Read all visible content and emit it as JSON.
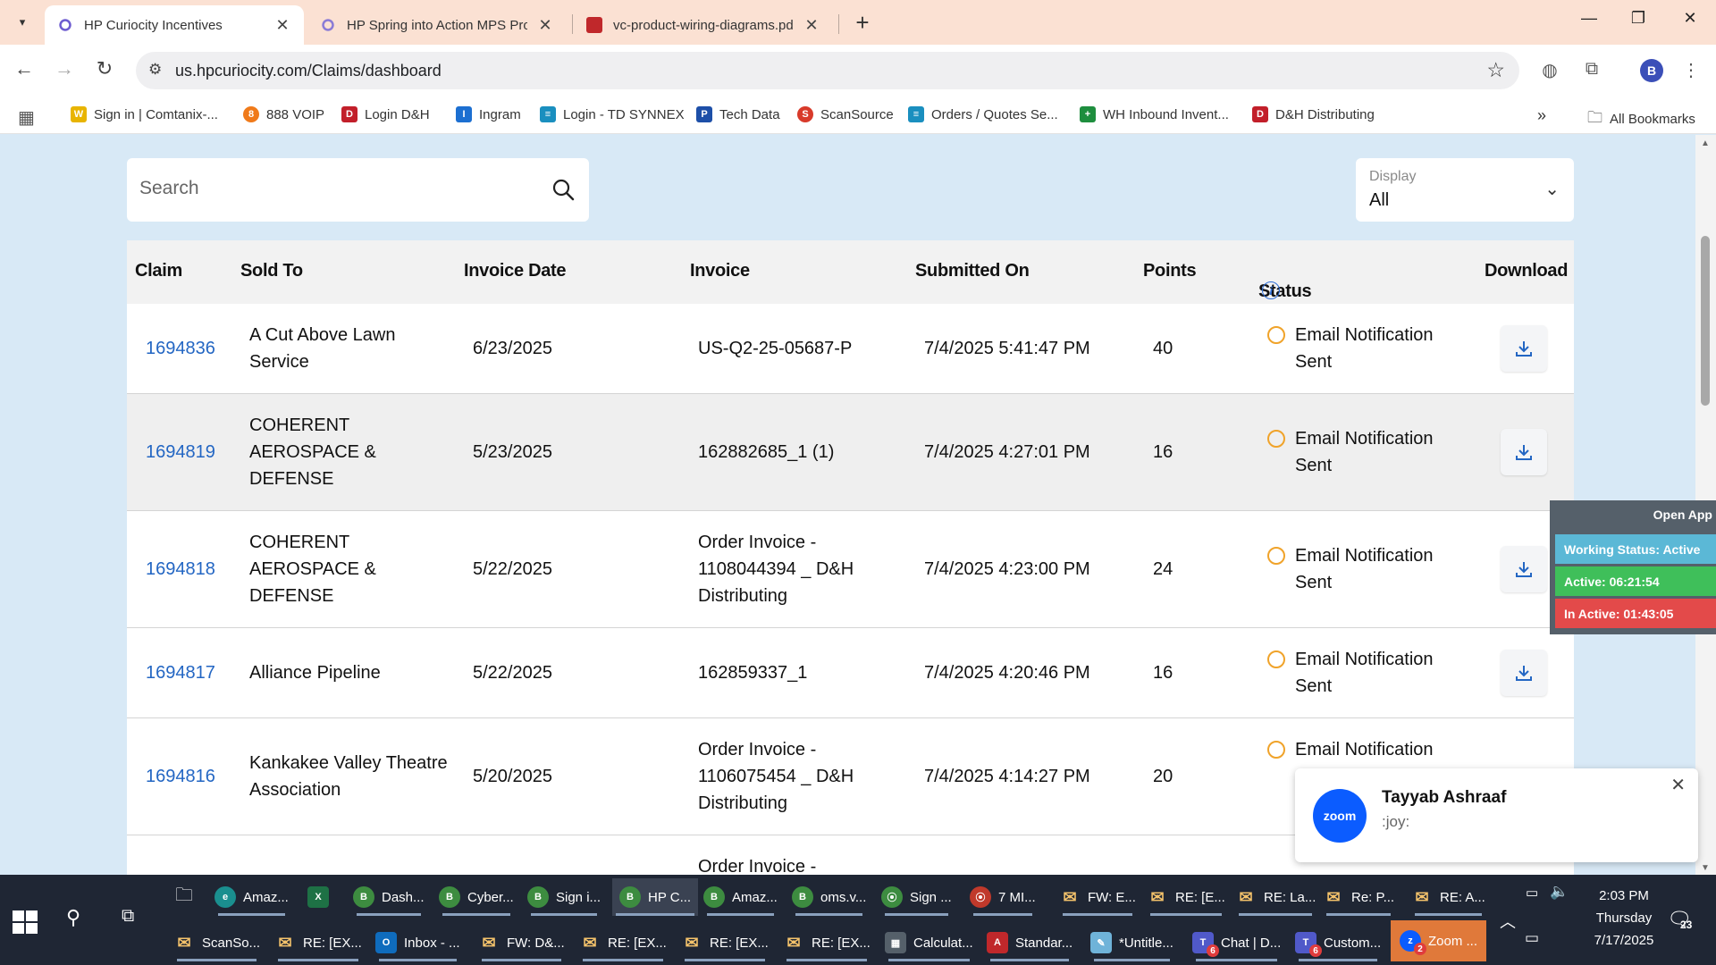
{
  "browser": {
    "tabs": [
      {
        "title": "HP Curiocity Incentives",
        "active": true
      },
      {
        "title": "HP Spring into Action MPS Pro",
        "active": false
      },
      {
        "title": "vc-product-wiring-diagrams.pd",
        "active": false
      }
    ],
    "url": "us.hpcuriocity.com/Claims/dashboard",
    "profile_initial": "B",
    "bookmarks": [
      "Sign in | Comtanix-...",
      "888 VOIP",
      "Login D&H",
      "Ingram",
      "Login - TD SYNNEX",
      "Tech Data",
      "ScanSource",
      "Orders / Quotes Se...",
      "WH Inbound Invent...",
      "D&H Distributing"
    ],
    "all_bookmarks": "All Bookmarks"
  },
  "page": {
    "search_placeholder": "Search",
    "display": {
      "label": "Display",
      "value": "All"
    },
    "columns": [
      "Claim",
      "Sold To",
      "Invoice Date",
      "Invoice",
      "Submitted On",
      "Points",
      "Status",
      "Download"
    ],
    "rows": [
      {
        "claim": "1694836",
        "sold_to": "A Cut Above Lawn Service",
        "invoice_date": "6/23/2025",
        "invoice": "US-Q2-25-05687-P",
        "submitted_on": "7/4/2025 5:41:47 PM",
        "points": "40",
        "status": "Email Notification Sent"
      },
      {
        "claim": "1694819",
        "sold_to": "COHERENT AEROSPACE & DEFENSE",
        "invoice_date": "5/23/2025",
        "invoice": "162882685_1 (1)",
        "submitted_on": "7/4/2025 4:27:01 PM",
        "points": "16",
        "status": "Email Notification Sent"
      },
      {
        "claim": "1694818",
        "sold_to": "COHERENT AEROSPACE & DEFENSE",
        "invoice_date": "5/22/2025",
        "invoice": "Order Invoice - 1108044394 _ D&H Distributing",
        "submitted_on": "7/4/2025 4:23:00 PM",
        "points": "24",
        "status": "Email Notification Sent"
      },
      {
        "claim": "1694817",
        "sold_to": "Alliance Pipeline",
        "invoice_date": "5/22/2025",
        "invoice": "162859337_1",
        "submitted_on": "7/4/2025 4:20:46 PM",
        "points": "16",
        "status": "Email Notification Sent"
      },
      {
        "claim": "1694816",
        "sold_to": "Kankakee Valley Theatre Association",
        "invoice_date": "5/20/2025",
        "invoice": "Order Invoice - 1106075454 _ D&H Distributing",
        "submitted_on": "7/4/2025 4:14:27 PM",
        "points": "20",
        "status": "Email Notification"
      },
      {
        "claim": "",
        "sold_to": "",
        "invoice_date": "",
        "invoice": "Order Invoice -",
        "submitted_on": "",
        "points": "",
        "status": ""
      }
    ]
  },
  "working_status": {
    "open_app": "Open App",
    "status": "Working Status: Active",
    "active": "Active: 06:21:54",
    "inactive": "In Active: 01:43:05"
  },
  "zoom_toast": {
    "logo": "zoom",
    "name": "Tayyab Ashraaf",
    "message": ":joy:"
  },
  "taskbar": {
    "row1": [
      "Amaz...",
      "Dash...",
      "Cyber...",
      "Sign i...",
      "HP C...",
      "Amaz...",
      "oms.v...",
      "Sign ...",
      "7 MI...",
      "FW: E...",
      "RE: [E...",
      "RE: La...",
      "Re: P...",
      "RE: A..."
    ],
    "row2": [
      "ScanSo...",
      "RE: [EX...",
      "Inbox - ...",
      "FW: D&...",
      "RE: [EX...",
      "RE: [EX...",
      "RE: [EX...",
      "Calculat...",
      "Standar...",
      "*Untitle...",
      "Chat | D...",
      "Custom...",
      "Zoom ..."
    ],
    "badges": {
      "chat": "6",
      "custom": "6",
      "zoom": "2",
      "notifications": "23"
    },
    "time": "2:03 PM",
    "day": "Thursday",
    "date": "7/17/2025"
  },
  "colors": {
    "link": "#2366c3",
    "status_ring": "#f0a32a",
    "active_bar": "#3fbf5a",
    "inactive_bar": "#e34a4a",
    "working_bar": "#5bb8d6"
  }
}
